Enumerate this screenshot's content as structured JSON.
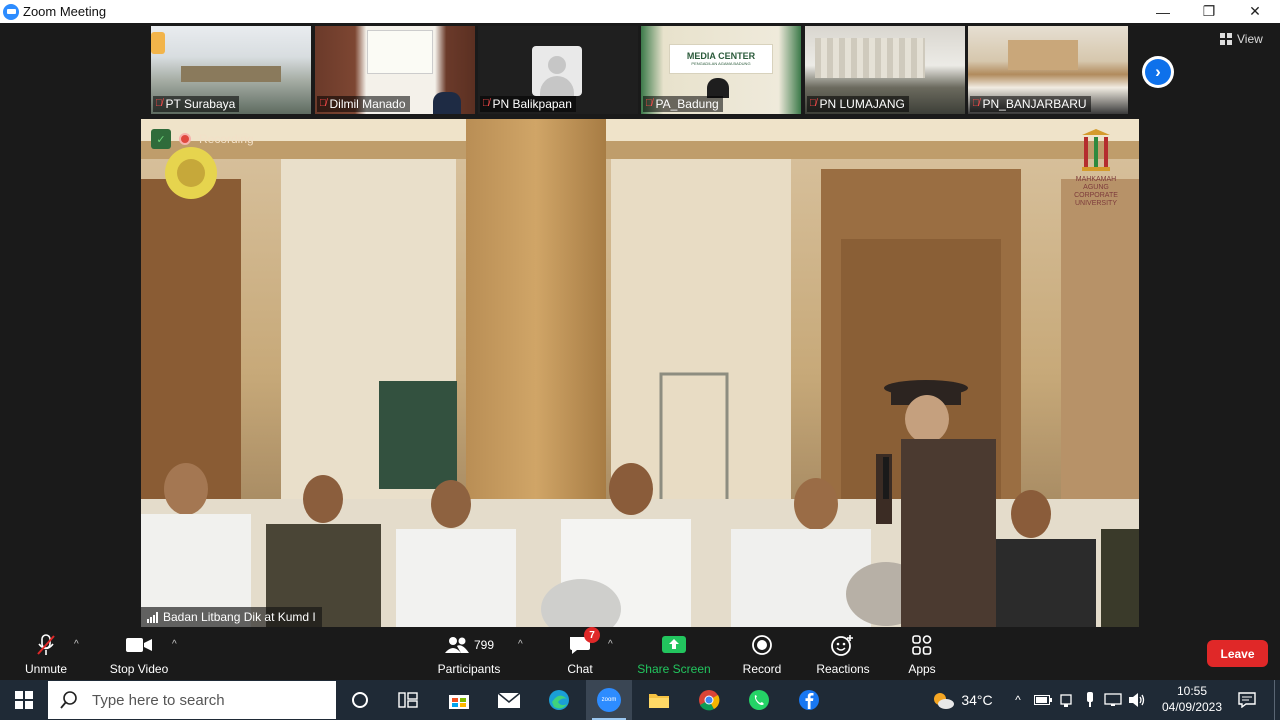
{
  "window": {
    "title": "Zoom Meeting",
    "controls": {
      "minimize": "—",
      "maximize": "❐",
      "close": "✕"
    }
  },
  "meeting": {
    "view_label": "View",
    "thumbnails": [
      {
        "name": "PT Surabaya"
      },
      {
        "name": "Dilmil Manado"
      },
      {
        "name": "PN Balikpapan"
      },
      {
        "name": "PA_Badung"
      },
      {
        "name": "PN LUMAJANG"
      },
      {
        "name": "PN_BANJARBARU"
      }
    ],
    "thumbnail_texts": {
      "media_center": "MEDIA CENTER",
      "pengadilan": "PENGADILAN AGAMA BADUNG"
    },
    "main_video": {
      "recording_label": "Recording",
      "speaker_name": "Badan Litbang Dik at Kumd I",
      "brand_text": "MAHKAMAH AGUNG CORPORATE UNIVERSITY"
    }
  },
  "toolbar": {
    "unmute": "Unmute",
    "stop_video": "Stop Video",
    "participants_count": "799",
    "participants": "Participants",
    "chat": "Chat",
    "chat_badge": "7",
    "share_screen": "Share Screen",
    "record": "Record",
    "reactions": "Reactions",
    "apps": "Apps",
    "leave": "Leave"
  },
  "taskbar": {
    "search_placeholder": "Type here to search",
    "temperature": "34°C",
    "time": "10:55",
    "date": "04/09/2023",
    "zoom_label": "zoom"
  },
  "colors": {
    "zoom_blue": "#0e71eb",
    "leave_red": "#e02828",
    "share_green": "#22c55e",
    "taskbar_bg": "#1f2a36"
  }
}
